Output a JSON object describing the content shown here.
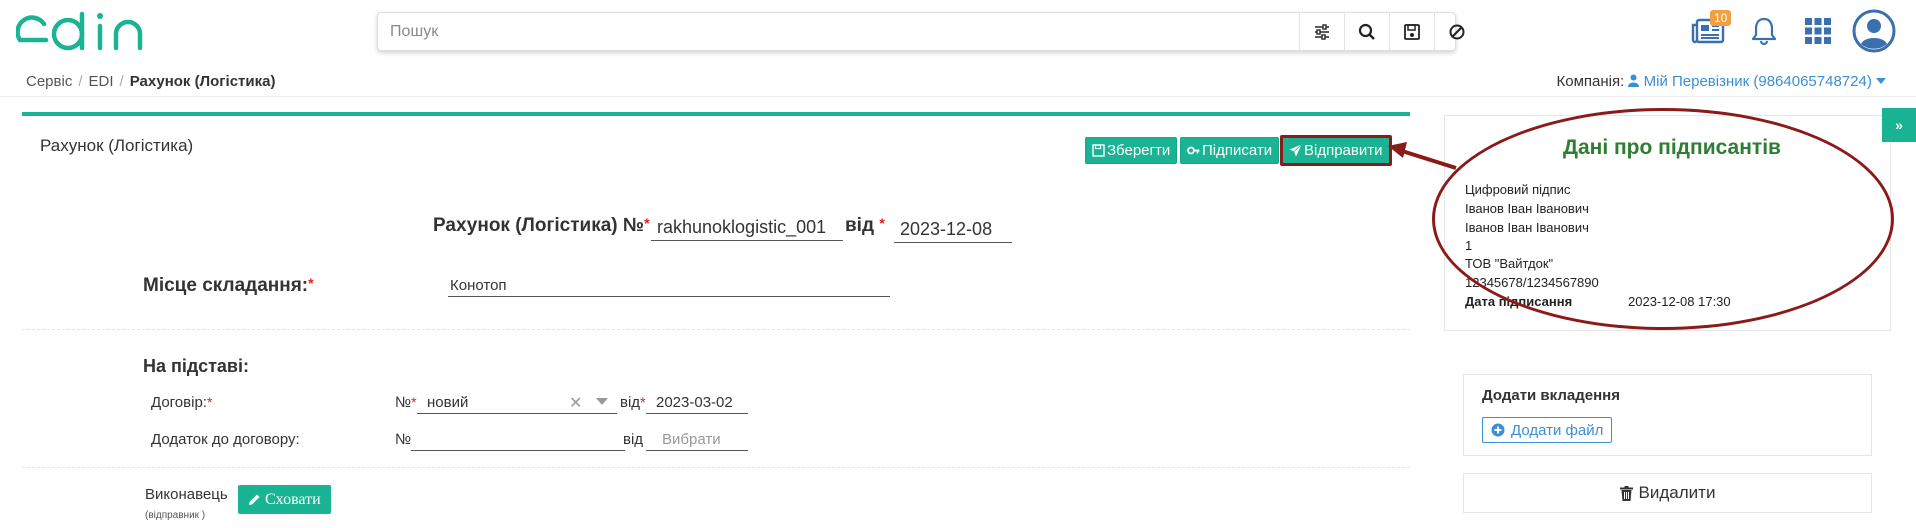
{
  "header": {
    "logo_text": "edin",
    "search_placeholder": "Пошук",
    "notifications_count": "10"
  },
  "breadcrumb": {
    "items": [
      "Сервіс",
      "EDI",
      "Рахунок (Логістика)"
    ]
  },
  "company": {
    "label": "Компанія:",
    "value": "Мій Перевізник (9864065748724)"
  },
  "document": {
    "panel_title": "Рахунок (Логістика)",
    "buttons": {
      "save": "Зберегти",
      "sign": "Підписати",
      "send": "Відправити"
    },
    "title_label": "Рахунок (Логістика) №",
    "required_mark": "*",
    "number": "rakhunoklogistic_001",
    "from_label": "від",
    "date": "2023-12-08",
    "place_label": "Місце складання:",
    "place_value": "Конотоп",
    "basis_label": "На підставі:",
    "contract_label": "Договір:",
    "contract_no_label": "№",
    "contract_value": "новий",
    "contract_from_label": "від",
    "contract_date": "2023-03-02",
    "addendum_label": "Додаток до договору:",
    "addendum_no_label": "№",
    "addendum_from_label": "від",
    "addendum_date_placeholder": "Вибрати",
    "executor_label": "Виконавець",
    "executor_sub": "(відправник )",
    "hide_button": "Сховати"
  },
  "signers": {
    "title": "Дані про підписантів",
    "lines": [
      "Цифровий підпис",
      "Іванов Іван Іванович",
      "Іванов Іван Іванович",
      "1",
      "ТОВ \"Вайтдок\"",
      "12345678/1234567890"
    ],
    "date_label": "Дата підписання",
    "date_value": "2023-12-08 17:30"
  },
  "attachments": {
    "title": "Додати вкладення",
    "add_file": "Додати файл"
  },
  "delete_label": "Видалити",
  "toggle_label": "»",
  "colors": {
    "accent": "#1ab394",
    "annotation": "#8b1a1a",
    "signers_title": "#2e7d32",
    "link": "#3a8fd8",
    "badge": "#f0a040"
  }
}
